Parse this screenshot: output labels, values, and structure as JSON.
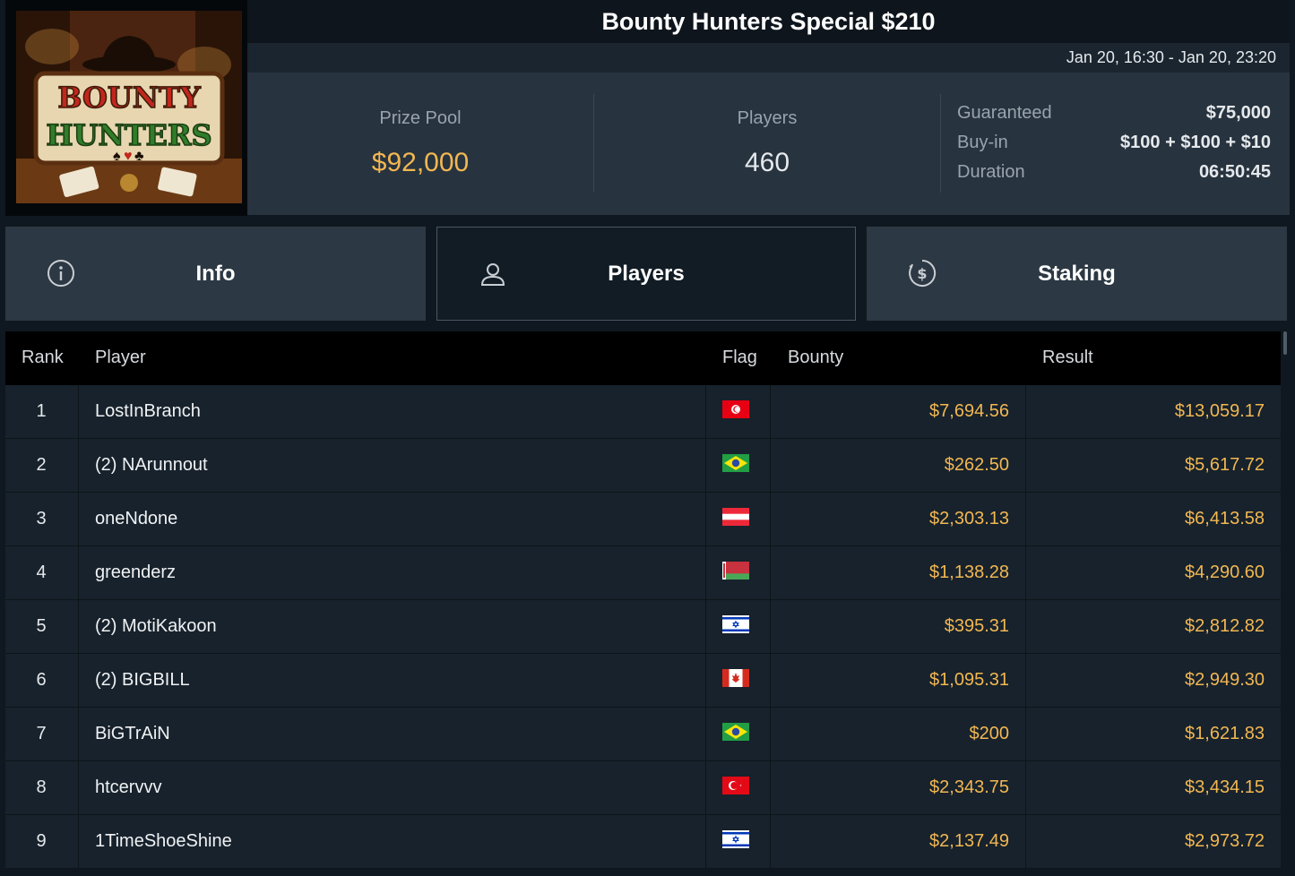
{
  "logo": {
    "line1": "BOUNTY",
    "line2": "HUNTERS"
  },
  "tournament": {
    "title": "Bounty Hunters Special $210",
    "dates": "Jan 20, 16:30 - Jan 20, 23:20"
  },
  "stats": {
    "prize_pool_label": "Prize Pool",
    "prize_pool_value": "$92,000",
    "players_label": "Players",
    "players_value": "460",
    "guaranteed_label": "Guaranteed",
    "guaranteed_value": "$75,000",
    "buyin_label": "Buy-in",
    "buyin_value": "$100 + $100 + $10",
    "duration_label": "Duration",
    "duration_value": "06:50:45"
  },
  "tabs": [
    {
      "label": "Info",
      "icon": "info-icon",
      "active": false
    },
    {
      "label": "Players",
      "icon": "user-icon",
      "active": true
    },
    {
      "label": "Staking",
      "icon": "dollar-circle-icon",
      "active": false
    }
  ],
  "table": {
    "headers": {
      "rank": "Rank",
      "player": "Player",
      "flag": "Flag",
      "bounty": "Bounty",
      "result": "Result"
    },
    "rows": [
      {
        "rank": "1",
        "player": "LostInBranch",
        "flag": "tunisia",
        "bounty": "$7,694.56",
        "result": "$13,059.17"
      },
      {
        "rank": "2",
        "player": "(2) NArunnout",
        "flag": "brazil",
        "bounty": "$262.50",
        "result": "$5,617.72"
      },
      {
        "rank": "3",
        "player": "oneNdone",
        "flag": "austria",
        "bounty": "$2,303.13",
        "result": "$6,413.58"
      },
      {
        "rank": "4",
        "player": "greenderz",
        "flag": "belarus",
        "bounty": "$1,138.28",
        "result": "$4,290.60"
      },
      {
        "rank": "5",
        "player": "(2) MotiKakoon",
        "flag": "israel",
        "bounty": "$395.31",
        "result": "$2,812.82"
      },
      {
        "rank": "6",
        "player": "(2) BIGBILL",
        "flag": "canada",
        "bounty": "$1,095.31",
        "result": "$2,949.30"
      },
      {
        "rank": "7",
        "player": "BiGTrAiN",
        "flag": "brazil",
        "bounty": "$200",
        "result": "$1,621.83"
      },
      {
        "rank": "8",
        "player": "htcervvv",
        "flag": "turkey",
        "bounty": "$2,343.75",
        "result": "$3,434.15"
      },
      {
        "rank": "9",
        "player": "1TimeShoeShine",
        "flag": "israel",
        "bounty": "$2,137.49",
        "result": "$2,973.72"
      }
    ]
  },
  "colors": {
    "gold": "#f2b752",
    "background": "#0f1820",
    "row": "#17222c"
  }
}
